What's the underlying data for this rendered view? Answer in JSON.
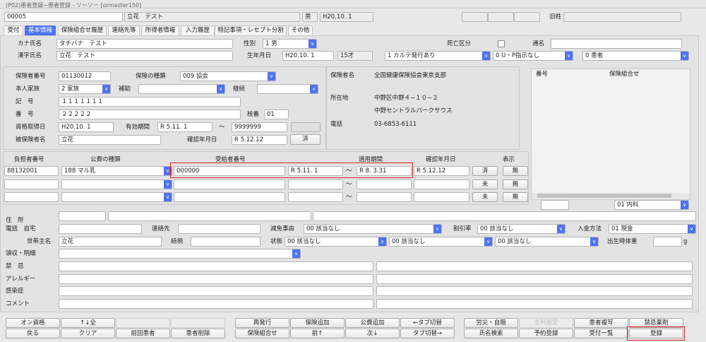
{
  "window": {
    "title": "(P02)患者登録−患者登録 - ソーソー [ormaster150]"
  },
  "header": {
    "patient_id": "00005",
    "name": "立花　テスト",
    "sex": "男",
    "birth": "H20.10. 1",
    "old_name_label": "旧姓",
    "old_name": ""
  },
  "tabs": [
    "受付",
    "基本情報",
    "保険組合せ履歴",
    "連絡先等",
    "所得者情報",
    "入力履歴",
    "特記事項・レセプト分割",
    "その他"
  ],
  "basic": {
    "kana_label": "カナ氏名",
    "kana": "タチバナ　テスト",
    "sex_label": "性別",
    "sex": "1 男",
    "death_label": "死亡区分",
    "alias_label": "通名",
    "kanji_label": "漢字氏名",
    "kanji": "立花　テスト",
    "birth_label": "生年月日",
    "birth": "H20.10. 1",
    "age": "15才",
    "karte": "1 カルテ発行あり",
    "up": "0 U・P指示なし",
    "patient_type": "0 患者"
  },
  "insurance": {
    "insurer_no_label": "保険者番号",
    "insurer_no": "01130012",
    "type_label": "保険の種類",
    "type": "009 協会",
    "family_label": "本人家族",
    "family": "2 家族",
    "aid_label": "補助",
    "aid": "",
    "cont_label": "継続",
    "cont": "",
    "symbol_label": "記　号",
    "symbol": "１１１１１１１",
    "number_label": "番　号",
    "number": "２２２２２",
    "branch_label": "枝番",
    "branch": "01",
    "qual_label": "資格取得日",
    "qual": "H20.10. 1",
    "valid_label": "有効期間",
    "valid_from": "R 5.11. 1",
    "tilde": "〜",
    "valid_to": "9999999",
    "insured_label": "被保険者名",
    "insured": "立花",
    "confirm_label": "確認年月日",
    "confirm": "R 5.12.12",
    "done": "済"
  },
  "insurer_info": {
    "name_label": "保険者名",
    "name": "全国健康保険協会東京支部",
    "addr_label": "所在地",
    "addr1": "中野区中野４−１０−２",
    "addr2": "中野セントラルパークサウス",
    "tel_label": "電話",
    "tel": "03-6853-6111"
  },
  "combo_list": {
    "col_no": "番号",
    "col_combo": "保険組合せ",
    "input": "",
    "dept": "01 内科"
  },
  "public": {
    "headers": [
      "負担者番号",
      "公費の種類",
      "受給者番号",
      "適用期間",
      "確認年月日",
      "表示"
    ],
    "rows": [
      {
        "payer": "88132001",
        "type": "188 マル乳",
        "recipient": "000000",
        "from": "R 5.11. 1",
        "to": "R 8. 3.31",
        "confirm": "R 5.12.12",
        "status": "済",
        "show": "無"
      },
      {
        "payer": "",
        "type": "",
        "recipient": "",
        "from": "",
        "to": "",
        "confirm": "",
        "status": "未",
        "show": "無"
      },
      {
        "payer": "",
        "type": "",
        "recipient": "",
        "from": "",
        "to": "",
        "confirm": "",
        "status": "未",
        "show": "無"
      }
    ],
    "tilde": "〜"
  },
  "contact": {
    "addr_label": "住　所",
    "tel_label": "電話　自宅",
    "contact_label": "連絡先",
    "reduce_label": "減免事由",
    "reduce": "00 該当なし",
    "discount_label": "割引率",
    "discount": "00 該当なし",
    "pay_label": "入金方法",
    "pay": "01 現金",
    "head_label": "世帯主名",
    "head": "立花",
    "rel_label": "続柄",
    "state_label": "状態",
    "state1": "00 該当なし",
    "state2": "00 該当なし",
    "state3": "00 該当なし",
    "weight_label": "出生時体重",
    "weight_unit": "g",
    "receipt_label": "領収・明細",
    "taboo_label": "禁　忌",
    "allergy_label": "アレルギー",
    "infect_label": "感染症",
    "comment_label": "コメント"
  },
  "buttons": {
    "row1": [
      "オン資格",
      "↑↓全",
      "",
      "",
      "再発行",
      "保険追加",
      "公費追加",
      "←タブ切替",
      "労災・自賠",
      "主科設定",
      "患者複写",
      "禁忌薬剤"
    ],
    "row2": [
      "戻る",
      "クリア",
      "前回患者",
      "患者削除",
      "保険組合せ",
      "前↑",
      "次↓",
      "タブ切替→",
      "氏名検索",
      "予約登録",
      "受付一覧",
      "登録"
    ]
  }
}
